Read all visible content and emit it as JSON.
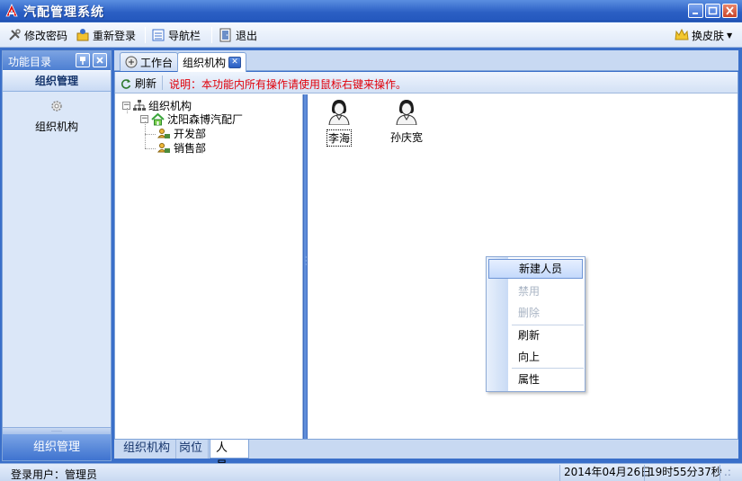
{
  "window": {
    "title": "汽配管理系统"
  },
  "toolbar": {
    "change_password": "修改密码",
    "relogin": "重新登录",
    "navbar": "导航栏",
    "exit": "退出",
    "skin": "换皮肤"
  },
  "sidebar": {
    "header": "功能目录",
    "section": "组织管理",
    "node": "组织机构",
    "grip": "……",
    "bottom_label": "组织管理"
  },
  "tabs": [
    {
      "label": "工作台"
    },
    {
      "label": "组织机构"
    }
  ],
  "commandbar": {
    "refresh": "刷新",
    "note": "说明：本功能内所有操作请使用鼠标右键来操作。"
  },
  "tree": {
    "root": "组织机构",
    "company": "沈阳森博汽配厂",
    "departments": [
      "开发部",
      "销售部"
    ]
  },
  "people": [
    {
      "name": "李海"
    },
    {
      "name": "孙庆宽"
    }
  ],
  "context_menu": {
    "items": [
      "新建人员",
      "禁用",
      "删除",
      "刷新",
      "向上",
      "属性"
    ]
  },
  "bottom_tabs": [
    "组织机构",
    "岗位",
    "人员"
  ],
  "statusbar": {
    "user": "登录用户：管理员",
    "date": "2014年04月26日",
    "time": "19时55分37秒"
  },
  "colors": {
    "accent": "#2b5fc4",
    "note_text": "#e0000a"
  }
}
